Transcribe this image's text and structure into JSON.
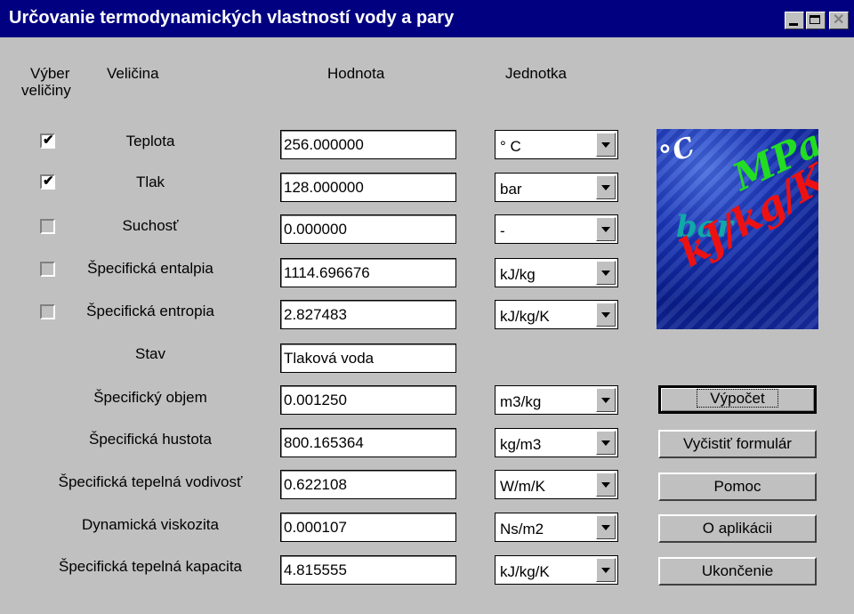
{
  "window": {
    "title": "Určovanie termodynamických vlastností vody a pary"
  },
  "headers": {
    "select_line1": "Výber",
    "select_line2": "veličiny",
    "quantity": "Veličina",
    "value": "Hodnota",
    "unit": "Jednotka"
  },
  "rows": [
    {
      "label": "Teplota",
      "checkbox": "checked",
      "value": "256.000000",
      "unit": "° C"
    },
    {
      "label": "Tlak",
      "checkbox": "checked",
      "value": "128.000000",
      "unit": "bar"
    },
    {
      "label": "Suchosť",
      "checkbox": "unchecked",
      "value": "0.000000",
      "unit": "-"
    },
    {
      "label": "Špecifická entalpia",
      "checkbox": "unchecked",
      "value": "1114.696676",
      "unit": "kJ/kg"
    },
    {
      "label": "Špecifická entropia",
      "checkbox": "unchecked",
      "value": "2.827483",
      "unit": "kJ/kg/K"
    },
    {
      "label": "Stav",
      "value": "Tlaková voda"
    },
    {
      "label": "Špecifický objem",
      "value": "0.001250",
      "unit": "m3/kg"
    },
    {
      "label": "Špecifická hustota",
      "value": "800.165364",
      "unit": "kg/m3"
    },
    {
      "label": "Špecifická tepelná vodivosť",
      "value": "0.622108",
      "unit": "W/m/K"
    },
    {
      "label": "Dynamická viskozita",
      "value": "0.000107",
      "unit": "Ns/m2"
    },
    {
      "label": "Špecifická tepelná kapacita",
      "value": "4.815555",
      "unit": "kJ/kg/K"
    }
  ],
  "buttons": {
    "calculate": "Výpočet",
    "clear": "Vyčistiť formulár",
    "help": "Pomoc",
    "about": "O aplikácii",
    "exit": "Ukončenie"
  },
  "logo": {
    "mpa": "MPa",
    "bar": "bar",
    "unit": "kJ/kg/K",
    "degree": "°C",
    "colors": {
      "mpa": "#22dd22",
      "bar": "#10a8a8",
      "unit": "#ee1111",
      "degree": "#ffffff"
    }
  },
  "checkmark": "✔"
}
